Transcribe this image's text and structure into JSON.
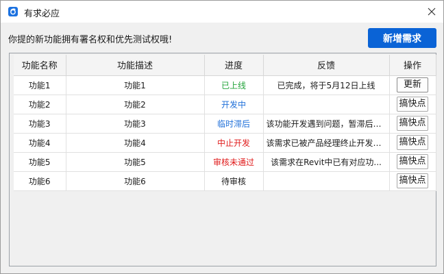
{
  "window": {
    "title": "有求必应",
    "icon": "app-logo-icon",
    "close_icon": "close-icon"
  },
  "notice": "你提的新功能拥有署名权和优先测试权哦!",
  "toolbar": {
    "add_request_label": "新增需求",
    "accent_color": "#0a63d6"
  },
  "table": {
    "columns": [
      "功能名称",
      "功能描述",
      "进度",
      "反馈",
      "操作"
    ],
    "rows": [
      {
        "name": "功能1",
        "desc": "功能1",
        "status": "已上线",
        "status_color": "#22a33a",
        "feedback": "已完成，将于5月12日上线",
        "action": "更新"
      },
      {
        "name": "功能2",
        "desc": "功能2",
        "status": "开发中",
        "status_color": "#1e6fd9",
        "feedback": "",
        "action": "搞快点"
      },
      {
        "name": "功能3",
        "desc": "功能3",
        "status": "临时滞后",
        "status_color": "#1e6fd9",
        "feedback": "该功能开发遇到问题，暂滞后，...",
        "action": "搞快点"
      },
      {
        "name": "功能4",
        "desc": "功能4",
        "status": "中止开发",
        "status_color": "#e01b1b",
        "feedback": "该需求已被产品经理终止开发，...",
        "action": "搞快点"
      },
      {
        "name": "功能5",
        "desc": "功能5",
        "status": "审核未通过",
        "status_color": "#e01b1b",
        "feedback": "该需求在Revit中已有对应功...",
        "action": "搞快点"
      },
      {
        "name": "功能6",
        "desc": "功能6",
        "status": "待审核",
        "status_color": "#1a1a1a",
        "feedback": "",
        "action": "搞快点"
      }
    ]
  }
}
